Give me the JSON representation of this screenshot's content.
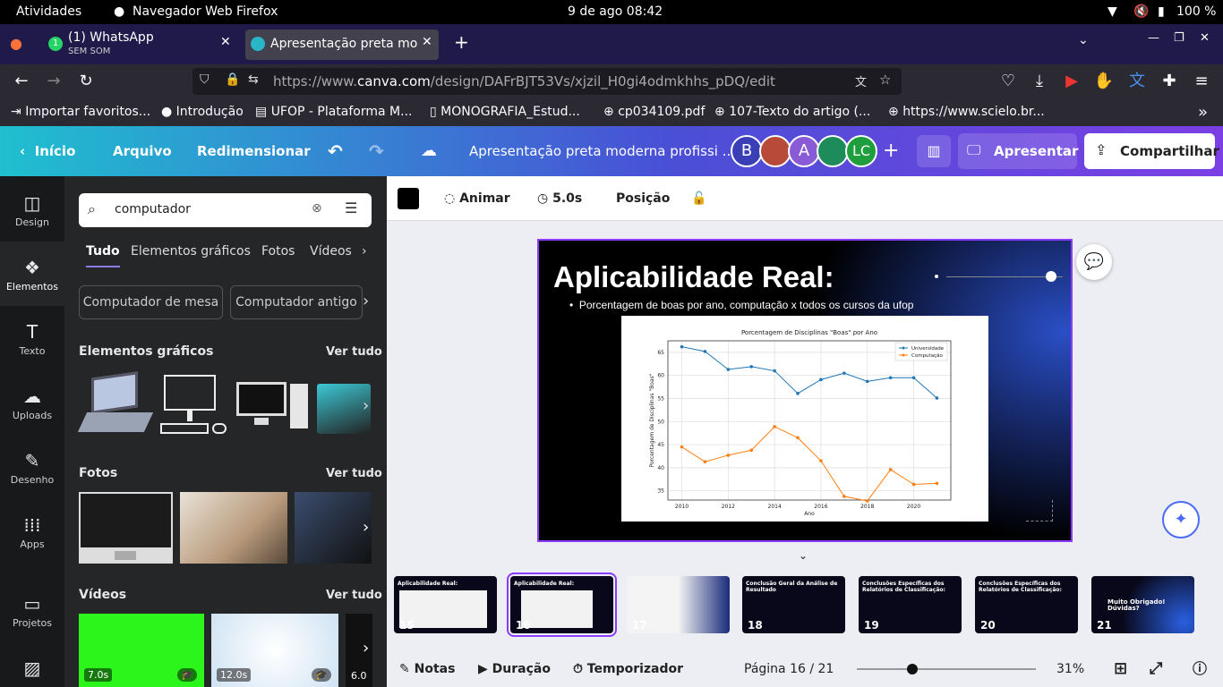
{
  "gnome": {
    "activities": "Atividades",
    "app": "Navegador Web Firefox",
    "clock": "9 de ago  08:42",
    "battery": "100 %"
  },
  "tabs": [
    {
      "title": "(1) WhatsApp",
      "subtitle": "SEM SOM"
    },
    {
      "title": "Apresentação preta mod"
    }
  ],
  "url": {
    "prefix": "https://www.",
    "domain": "canva.com",
    "path": "/design/DAFrBJT53Vs/xjzil_H0gi4odmkhhs_pDQ/edit"
  },
  "bookmarks": [
    "Importar favoritos...",
    "Introdução",
    "UFOP - Plataforma M...",
    "MONOGRAFIA_Estud...",
    "cp034109.pdf",
    "107-Texto do artigo (...",
    "https://www.scielo.br..."
  ],
  "canva": {
    "home": "Início",
    "file": "Arquivo",
    "resize": "Redimensionar",
    "doc_title": "Apresentação preta moderna profissi ...",
    "avatars": [
      "B",
      "A",
      "LC"
    ],
    "present": "Apresentar",
    "share": "Compartilhar"
  },
  "rail": [
    {
      "label": "Design",
      "icon": "design-icon"
    },
    {
      "label": "Elementos",
      "icon": "elements-icon"
    },
    {
      "label": "Texto",
      "icon": "text-icon"
    },
    {
      "label": "Uploads",
      "icon": "upload-icon"
    },
    {
      "label": "Desenho",
      "icon": "draw-icon"
    },
    {
      "label": "Apps",
      "icon": "apps-icon"
    },
    {
      "label": "Projetos",
      "icon": "folder-icon"
    }
  ],
  "panel": {
    "search": "computador",
    "filters": [
      "Tudo",
      "Elementos gráficos",
      "Fotos",
      "Vídeos"
    ],
    "chips": [
      "Computador de mesa",
      "Computador antigo"
    ],
    "graphics_title": "Elementos gráficos",
    "photos_title": "Fotos",
    "videos_title": "Vídeos",
    "see_all": "Ver tudo",
    "video_durations": [
      "7.0s",
      "12.0s",
      "6.0"
    ]
  },
  "toolbar": {
    "animate": "Animar",
    "duration": "5.0s",
    "position": "Posição"
  },
  "slide": {
    "title": "Aplicabilidade Real:",
    "bullet": "Porcentagem de boas por ano, computação x todos os cursos da ufop"
  },
  "chart_data": {
    "type": "line",
    "title": "Porcentagem de Disciplinas \"Boas\" por Ano",
    "xlabel": "Ano",
    "ylabel": "Porcentagem de Disciplinas \"Boas\"",
    "x": [
      2010,
      2011,
      2012,
      2013,
      2014,
      2015,
      2016,
      2017,
      2018,
      2019,
      2020,
      2021
    ],
    "xticks": [
      2010,
      2012,
      2014,
      2016,
      2018,
      2020
    ],
    "yticks": [
      35,
      40,
      45,
      50,
      55,
      60,
      65
    ],
    "ylim": [
      33,
      67.5
    ],
    "series": [
      {
        "name": "Universidade",
        "color": "#1f77b4",
        "values": [
          66.2,
          65.2,
          61.3,
          61.9,
          61.0,
          56.1,
          59.1,
          60.5,
          58.7,
          59.5,
          59.5,
          55.1
        ]
      },
      {
        "name": "Computação",
        "color": "#ff7f0e",
        "values": [
          44.5,
          41.3,
          42.7,
          43.8,
          48.9,
          46.5,
          41.5,
          33.8,
          32.8,
          39.6,
          36.4,
          36.6
        ]
      }
    ],
    "legend": "top-right",
    "grid": true
  },
  "thumbs": [
    {
      "n": "15",
      "t": "Aplicabilidade Real:"
    },
    {
      "n": "16",
      "t": "Aplicabilidade Real:"
    },
    {
      "n": "17",
      "t": ""
    },
    {
      "n": "18",
      "t": "Conclusão Geral da Análise de Resultado"
    },
    {
      "n": "19",
      "t": "Conclusões Específicas dos Relatórios de Classificação:"
    },
    {
      "n": "20",
      "t": "Conclusões Específicas dos Relatórios de Classificação:"
    },
    {
      "n": "21",
      "t": "Muito Obrigado! Dúvidas?"
    }
  ],
  "bottom": {
    "notes": "Notas",
    "duration": "Duração",
    "timer": "Temporizador",
    "page": "Página 16 / 21",
    "zoom": "31%"
  }
}
